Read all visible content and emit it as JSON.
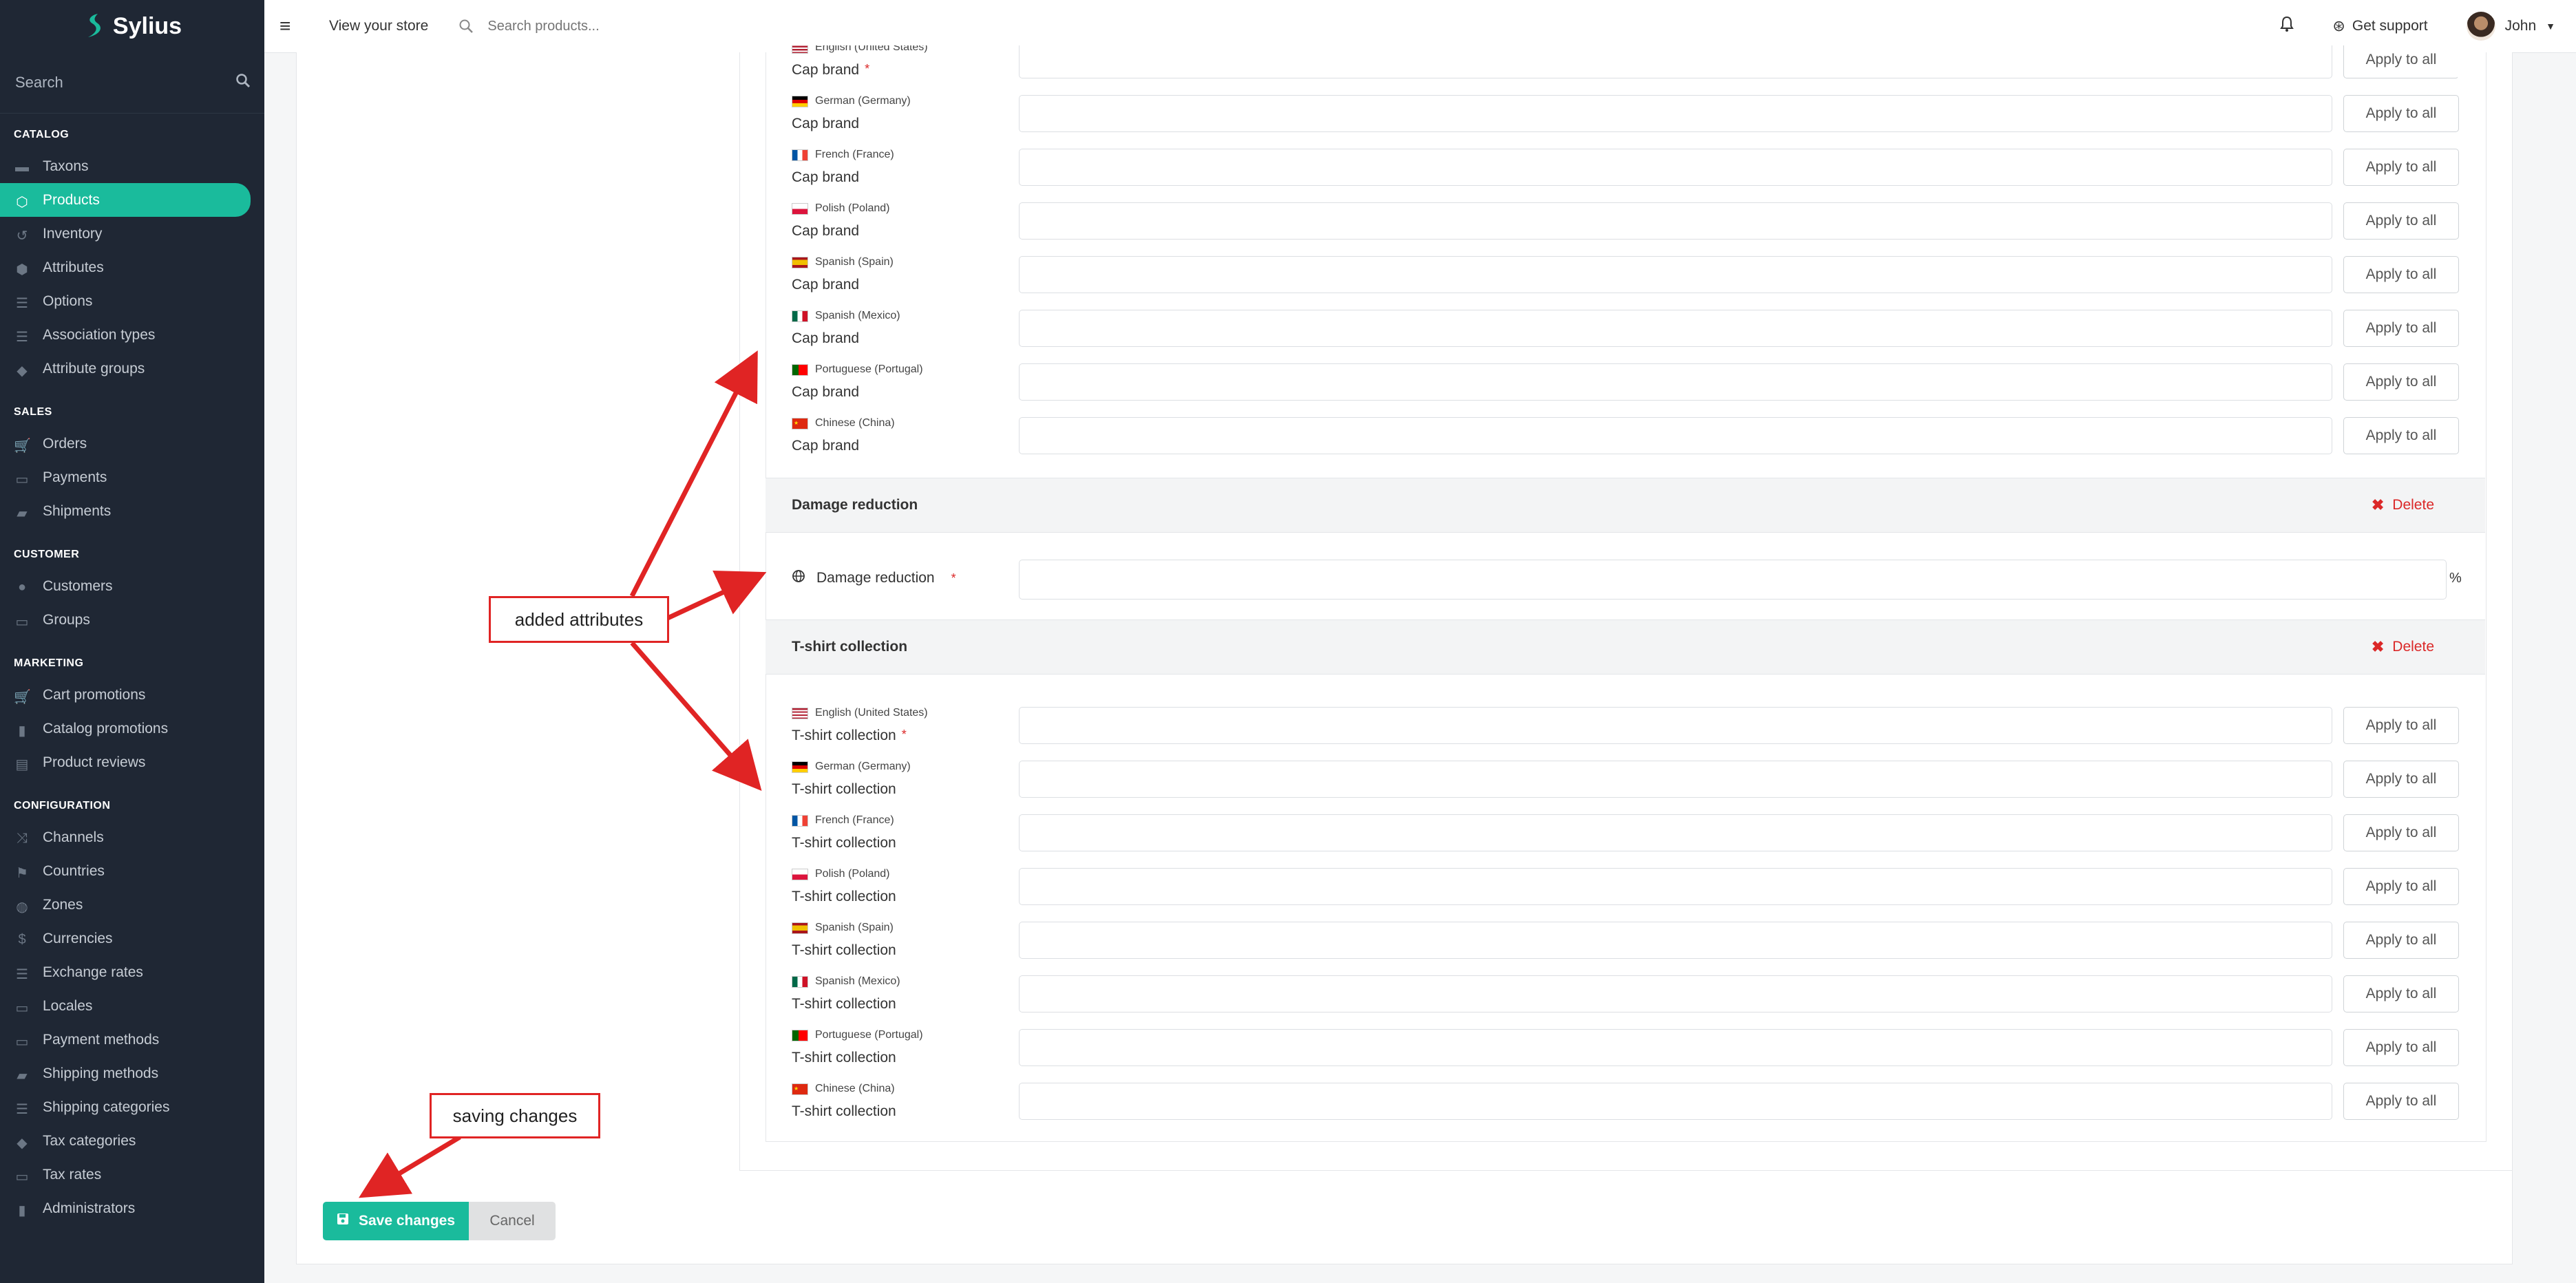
{
  "sidebar": {
    "logo": "Sylius",
    "search_placeholder": "Search",
    "sections": [
      {
        "title": "CATALOG",
        "items": [
          {
            "label": "Taxons",
            "icon": "folder-icon"
          },
          {
            "label": "Products",
            "icon": "cube-icon",
            "active": true
          },
          {
            "label": "Inventory",
            "icon": "history-icon"
          },
          {
            "label": "Attributes",
            "icon": "cubes-icon"
          },
          {
            "label": "Options",
            "icon": "options-icon"
          },
          {
            "label": "Association types",
            "icon": "list-icon"
          },
          {
            "label": "Attribute groups",
            "icon": "tag-icon"
          }
        ]
      },
      {
        "title": "SALES",
        "items": [
          {
            "label": "Orders",
            "icon": "cart-icon"
          },
          {
            "label": "Payments",
            "icon": "payment-icon"
          },
          {
            "label": "Shipments",
            "icon": "truck-icon"
          }
        ]
      },
      {
        "title": "CUSTOMER",
        "items": [
          {
            "label": "Customers",
            "icon": "users-icon"
          },
          {
            "label": "Groups",
            "icon": "archive-icon"
          }
        ]
      },
      {
        "title": "MARKETING",
        "items": [
          {
            "label": "Cart promotions",
            "icon": "cart-icon"
          },
          {
            "label": "Catalog promotions",
            "icon": "bookmark-icon"
          },
          {
            "label": "Product reviews",
            "icon": "newspaper-icon"
          }
        ]
      },
      {
        "title": "CONFIGURATION",
        "items": [
          {
            "label": "Channels",
            "icon": "random-icon"
          },
          {
            "label": "Countries",
            "icon": "flag-icon"
          },
          {
            "label": "Zones",
            "icon": "globe-icon"
          },
          {
            "label": "Currencies",
            "icon": "dollar-icon"
          },
          {
            "label": "Exchange rates",
            "icon": "sliders-icon"
          },
          {
            "label": "Locales",
            "icon": "translate-icon"
          },
          {
            "label": "Payment methods",
            "icon": "payment-icon"
          },
          {
            "label": "Shipping methods",
            "icon": "truck-icon"
          },
          {
            "label": "Shipping categories",
            "icon": "list-icon"
          },
          {
            "label": "Tax categories",
            "icon": "tags-icon"
          },
          {
            "label": "Tax rates",
            "icon": "money-icon"
          },
          {
            "label": "Administrators",
            "icon": "lock-icon"
          }
        ]
      }
    ]
  },
  "topbar": {
    "view_store": "View your store",
    "search_placeholder": "Search products...",
    "support": "Get support",
    "user": "John"
  },
  "attributes": {
    "apply_label": "Apply to all",
    "delete_label": "Delete",
    "cap_brand": {
      "label": "Cap brand",
      "locales": [
        {
          "lang": "English (United States)",
          "flag": "us",
          "required": true
        },
        {
          "lang": "German (Germany)",
          "flag": "de"
        },
        {
          "lang": "French (France)",
          "flag": "fr"
        },
        {
          "lang": "Polish (Poland)",
          "flag": "pl"
        },
        {
          "lang": "Spanish (Spain)",
          "flag": "es"
        },
        {
          "lang": "Spanish (Mexico)",
          "flag": "mx"
        },
        {
          "lang": "Portuguese (Portugal)",
          "flag": "pt"
        },
        {
          "lang": "Chinese (China)",
          "flag": "cn"
        }
      ]
    },
    "damage_reduction": {
      "title": "Damage reduction",
      "label": "Damage reduction",
      "unit": "%"
    },
    "tshirt_collection": {
      "title": "T-shirt collection",
      "label": "T-shirt collection",
      "locales": [
        {
          "lang": "English (United States)",
          "flag": "us",
          "required": true
        },
        {
          "lang": "German (Germany)",
          "flag": "de"
        },
        {
          "lang": "French (France)",
          "flag": "fr"
        },
        {
          "lang": "Polish (Poland)",
          "flag": "pl"
        },
        {
          "lang": "Spanish (Spain)",
          "flag": "es"
        },
        {
          "lang": "Spanish (Mexico)",
          "flag": "mx"
        },
        {
          "lang": "Portuguese (Portugal)",
          "flag": "pt"
        },
        {
          "lang": "Chinese (China)",
          "flag": "cn"
        }
      ]
    }
  },
  "actions": {
    "save": "Save changes",
    "cancel": "Cancel"
  },
  "annotations": {
    "added_attributes": "added attributes",
    "saving_changes": "saving changes"
  },
  "colors": {
    "accent": "#1abb9c",
    "sidebar_bg": "#1f2734",
    "danger": "#db2828",
    "callout": "#e02424"
  }
}
